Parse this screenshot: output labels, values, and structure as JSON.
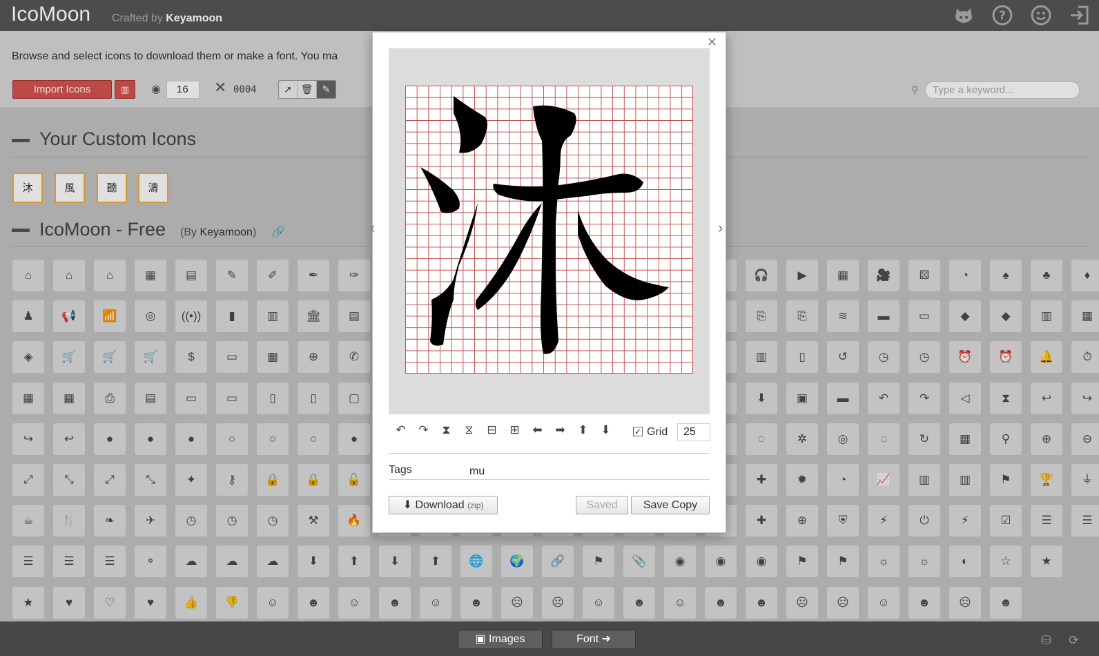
{
  "app": {
    "logo": "IcoMoon",
    "crafted_by": "Crafted by",
    "author": "Keyamoon",
    "intro": "Browse and select icons to download them or make a font. You ma"
  },
  "toolbar": {
    "import_label": "Import Icons",
    "size_value": "16",
    "selected_count": "0004",
    "search_placeholder": "Type a keyword..."
  },
  "sections": {
    "custom_title": "Your Custom Icons",
    "free_title": "IcoMoon - Free",
    "free_by": "(By",
    "free_author": "Keyamoon",
    "free_by_close": ")"
  },
  "custom_icons": [
    "沐",
    "風",
    "聽",
    "濤"
  ],
  "editor": {
    "tags_label": "Tags",
    "tags_value": "mu",
    "grid_label": "Grid",
    "grid_value": "25",
    "grid_checked": "✓",
    "download_label": "Download",
    "download_suffix": "(zip)",
    "saved_label": "Saved",
    "save_copy_label": "Save Copy"
  },
  "bottom": {
    "images_label": "Images",
    "font_label": "Font"
  },
  "colors": {
    "accent": "#d8544f",
    "grid_line": "#c0504d",
    "custom_border": "#f0b040"
  }
}
